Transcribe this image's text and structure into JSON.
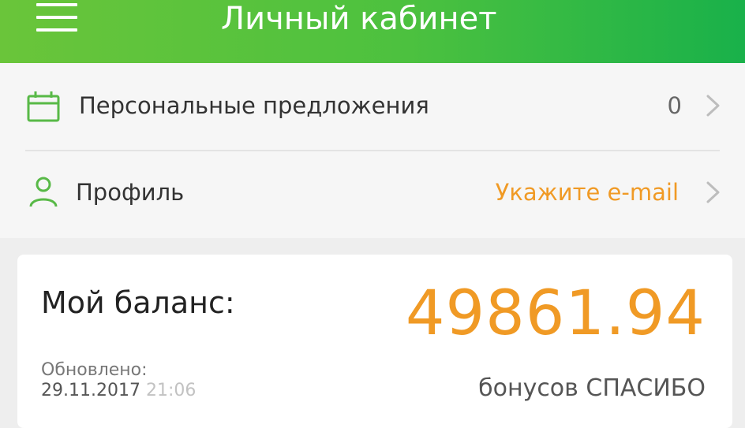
{
  "header": {
    "title": "Личный кабинет",
    "menu_icon": "hamburger-menu-icon"
  },
  "menu": [
    {
      "icon": "calendar-icon",
      "label": "Персональные предложения",
      "value": "0"
    },
    {
      "icon": "user-icon",
      "label": "Профиль",
      "value": "Укажите e-mail"
    }
  ],
  "balance": {
    "label": "Мой баланс:",
    "amount": "49861.94",
    "unit": "бонусов СПАСИБО",
    "updated_label": "Обновлено:",
    "updated_date": "29.11.2017",
    "updated_time": "21:06"
  },
  "colors": {
    "accent_green": "#4cc13f",
    "amount_orange": "#f09a25"
  }
}
